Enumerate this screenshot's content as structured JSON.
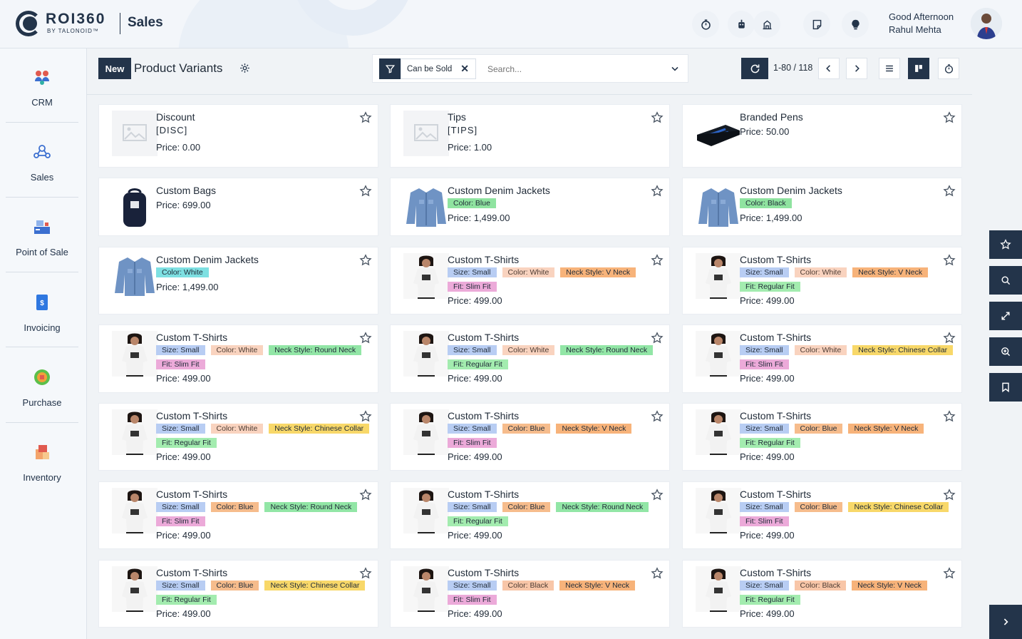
{
  "header": {
    "brand_main": "ROI360",
    "brand_sub": "BY TALONOID™",
    "app_title": "Sales",
    "greeting": "Good Afternoon",
    "user_name": "Rahul Mehta",
    "icons": [
      "timer-icon",
      "robot-icon",
      "building-icon",
      "notes-icon",
      "lightbulb-icon"
    ]
  },
  "sidebar": {
    "items": [
      {
        "label": "CRM",
        "icon": "crm-icon"
      },
      {
        "label": "Sales",
        "icon": "sales-icon"
      },
      {
        "label": "Point of Sale",
        "icon": "pos-icon"
      },
      {
        "label": "Invoicing",
        "icon": "invoicing-icon"
      },
      {
        "label": "Purchase",
        "icon": "purchase-icon"
      },
      {
        "label": "Inventory",
        "icon": "inventory-icon"
      }
    ]
  },
  "controls": {
    "new_label": "New",
    "page_title": "Product Variants",
    "facet_label": "Can be Sold",
    "search_placeholder": "Search...",
    "pager": "1-80 / 118"
  },
  "products": [
    {
      "name": "Discount",
      "code": "[DISC]",
      "price": "Price: 0.00",
      "image": "placeholder",
      "tags": []
    },
    {
      "name": "Tips",
      "code": "[TIPS]",
      "price": "Price: 1.00",
      "image": "placeholder",
      "tags": []
    },
    {
      "name": "Branded Pens",
      "price": "Price: 50.00",
      "image": "pens",
      "tags": []
    },
    {
      "name": "Custom Bags",
      "price": "Price: 699.00",
      "image": "bag",
      "tags": []
    },
    {
      "name": "Custom Denim Jackets",
      "price": "Price: 1,499.00",
      "image": "jacket",
      "tags": [
        {
          "text": "Color: Blue",
          "cls": "t-color-green"
        }
      ]
    },
    {
      "name": "Custom Denim Jackets",
      "price": "Price: 1,499.00",
      "image": "jacket",
      "tags": [
        {
          "text": "Color: Black",
          "cls": "t-color-green"
        }
      ]
    },
    {
      "name": "Custom Denim Jackets",
      "price": "Price: 1,499.00",
      "image": "jacket",
      "tags": [
        {
          "text": "Color: White",
          "cls": "t-color-cyan"
        }
      ]
    },
    {
      "name": "Custom T-Shirts",
      "price": "Price: 499.00",
      "image": "tshirt",
      "tags": [
        {
          "text": "Size: Small",
          "cls": "t-size"
        },
        {
          "text": "Color: White",
          "cls": "t-color-white"
        },
        {
          "text": "Neck Style: V Neck",
          "cls": "t-neck-v"
        },
        {
          "text": "Fit: Slim Fit",
          "cls": "t-fit-slim"
        }
      ]
    },
    {
      "name": "Custom T-Shirts",
      "price": "Price: 499.00",
      "image": "tshirt",
      "tags": [
        {
          "text": "Size: Small",
          "cls": "t-size"
        },
        {
          "text": "Color: White",
          "cls": "t-color-white"
        },
        {
          "text": "Neck Style: V Neck",
          "cls": "t-neck-v"
        },
        {
          "text": "Fit: Regular Fit",
          "cls": "t-fit-regular"
        }
      ]
    },
    {
      "name": "Custom T-Shirts",
      "price": "Price: 499.00",
      "image": "tshirt",
      "tags": [
        {
          "text": "Size: Small",
          "cls": "t-size"
        },
        {
          "text": "Color: White",
          "cls": "t-color-white"
        },
        {
          "text": "Neck Style: Round Neck",
          "cls": "t-neck-round"
        },
        {
          "text": "Fit: Slim Fit",
          "cls": "t-fit-slim"
        }
      ]
    },
    {
      "name": "Custom T-Shirts",
      "price": "Price: 499.00",
      "image": "tshirt",
      "tags": [
        {
          "text": "Size: Small",
          "cls": "t-size"
        },
        {
          "text": "Color: White",
          "cls": "t-color-white"
        },
        {
          "text": "Neck Style: Round Neck",
          "cls": "t-neck-round"
        },
        {
          "text": "Fit: Regular Fit",
          "cls": "t-fit-regular"
        }
      ]
    },
    {
      "name": "Custom T-Shirts",
      "price": "Price: 499.00",
      "image": "tshirt",
      "tags": [
        {
          "text": "Size: Small",
          "cls": "t-size"
        },
        {
          "text": "Color: White",
          "cls": "t-color-white"
        },
        {
          "text": "Neck Style: Chinese Collar",
          "cls": "t-neck-chinese"
        },
        {
          "text": "Fit: Slim Fit",
          "cls": "t-fit-slim"
        }
      ]
    },
    {
      "name": "Custom T-Shirts",
      "price": "Price: 499.00",
      "image": "tshirt",
      "tags": [
        {
          "text": "Size: Small",
          "cls": "t-size"
        },
        {
          "text": "Color: White",
          "cls": "t-color-white"
        },
        {
          "text": "Neck Style: Chinese Collar",
          "cls": "t-neck-chinese"
        },
        {
          "text": "Fit: Regular Fit",
          "cls": "t-fit-regular"
        }
      ]
    },
    {
      "name": "Custom T-Shirts",
      "price": "Price: 499.00",
      "image": "tshirt",
      "tags": [
        {
          "text": "Size: Small",
          "cls": "t-size"
        },
        {
          "text": "Color: Blue",
          "cls": "t-color-blue"
        },
        {
          "text": "Neck Style: V Neck",
          "cls": "t-neck-v"
        },
        {
          "text": "Fit: Slim Fit",
          "cls": "t-fit-slim"
        }
      ]
    },
    {
      "name": "Custom T-Shirts",
      "price": "Price: 499.00",
      "image": "tshirt",
      "tags": [
        {
          "text": "Size: Small",
          "cls": "t-size"
        },
        {
          "text": "Color: Blue",
          "cls": "t-color-blue"
        },
        {
          "text": "Neck Style: V Neck",
          "cls": "t-neck-v"
        },
        {
          "text": "Fit: Regular Fit",
          "cls": "t-fit-regular"
        }
      ]
    },
    {
      "name": "Custom T-Shirts",
      "price": "Price: 499.00",
      "image": "tshirt",
      "tags": [
        {
          "text": "Size: Small",
          "cls": "t-size"
        },
        {
          "text": "Color: Blue",
          "cls": "t-color-blue"
        },
        {
          "text": "Neck Style: Round Neck",
          "cls": "t-neck-round"
        },
        {
          "text": "Fit: Slim Fit",
          "cls": "t-fit-slim"
        }
      ]
    },
    {
      "name": "Custom T-Shirts",
      "price": "Price: 499.00",
      "image": "tshirt",
      "tags": [
        {
          "text": "Size: Small",
          "cls": "t-size"
        },
        {
          "text": "Color: Blue",
          "cls": "t-color-blue"
        },
        {
          "text": "Neck Style: Round Neck",
          "cls": "t-neck-round"
        },
        {
          "text": "Fit: Regular Fit",
          "cls": "t-fit-regular"
        }
      ]
    },
    {
      "name": "Custom T-Shirts",
      "price": "Price: 499.00",
      "image": "tshirt",
      "tags": [
        {
          "text": "Size: Small",
          "cls": "t-size"
        },
        {
          "text": "Color: Blue",
          "cls": "t-color-blue"
        },
        {
          "text": "Neck Style: Chinese Collar",
          "cls": "t-neck-chinese"
        },
        {
          "text": "Fit: Slim Fit",
          "cls": "t-fit-slim"
        }
      ]
    },
    {
      "name": "Custom T-Shirts",
      "price": "Price: 499.00",
      "image": "tshirt",
      "tags": [
        {
          "text": "Size: Small",
          "cls": "t-size"
        },
        {
          "text": "Color: Blue",
          "cls": "t-color-blue"
        },
        {
          "text": "Neck Style: Chinese Collar",
          "cls": "t-neck-chinese"
        },
        {
          "text": "Fit: Regular Fit",
          "cls": "t-fit-regular"
        }
      ]
    },
    {
      "name": "Custom T-Shirts",
      "price": "Price: 499.00",
      "image": "tshirt",
      "tags": [
        {
          "text": "Size: Small",
          "cls": "t-size"
        },
        {
          "text": "Color: Black",
          "cls": "t-color-black"
        },
        {
          "text": "Neck Style: V Neck",
          "cls": "t-neck-v"
        },
        {
          "text": "Fit: Slim Fit",
          "cls": "t-fit-slim"
        }
      ]
    },
    {
      "name": "Custom T-Shirts",
      "price": "Price: 499.00",
      "image": "tshirt",
      "tags": [
        {
          "text": "Size: Small",
          "cls": "t-size"
        },
        {
          "text": "Color: Black",
          "cls": "t-color-black"
        },
        {
          "text": "Neck Style: V Neck",
          "cls": "t-neck-v"
        },
        {
          "text": "Fit: Regular Fit",
          "cls": "t-fit-regular"
        }
      ]
    }
  ],
  "dock": [
    "star-icon",
    "search-icon",
    "expand-icon",
    "zoom-icon",
    "bookmark-icon"
  ],
  "colors": {
    "primary": "#23344a",
    "background": "#f0f3f6"
  }
}
